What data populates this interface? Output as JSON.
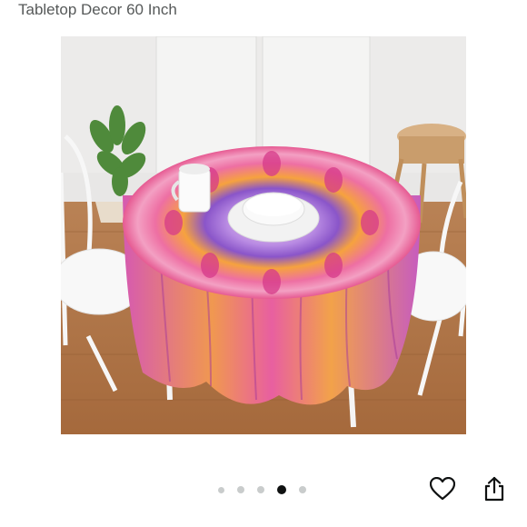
{
  "product": {
    "title": "Tabletop Decor 60 Inch"
  },
  "image": {
    "subject": "round mandala tablecloth on dining table with white chairs",
    "colors": {
      "wall": "#ecebea",
      "floor": "#b07a4a",
      "cloth_pink": "#f07aa6",
      "cloth_orange": "#f5a13a",
      "cloth_purple": "#8a55c9",
      "cloth_magenta": "#d63a8a"
    }
  },
  "carousel": {
    "dot_count": 5,
    "active_index": 3
  },
  "actions": {
    "favorite_icon": "heart-outline-icon",
    "share_icon": "share-icon"
  }
}
